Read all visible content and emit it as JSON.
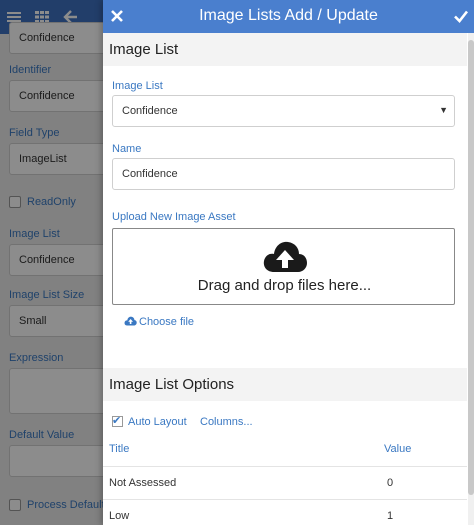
{
  "background": {
    "fields": [
      {
        "label": "",
        "value": "Confidence"
      },
      {
        "label": "Identifier",
        "value": "Confidence"
      },
      {
        "label": "Field Type",
        "value": "ImageList"
      },
      {
        "label": "Image List",
        "value": "Confidence"
      },
      {
        "label": "Image List Size",
        "value": "Small"
      },
      {
        "label": "Expression",
        "value": ""
      },
      {
        "label": "Default Value",
        "value": ""
      }
    ],
    "readonly_label": "ReadOnly",
    "process_default_label": "Process Default"
  },
  "dialog": {
    "title": "Image Lists Add / Update",
    "section_image_list": "Image List",
    "image_list_label": "Image List",
    "image_list_value": "Confidence",
    "name_label": "Name",
    "name_value": "Confidence",
    "upload_label": "Upload New Image Asset",
    "dropzone_text": "Drag and drop files here...",
    "choose_file": "Choose file",
    "section_options": "Image List Options",
    "auto_layout_label": "Auto Layout",
    "auto_layout_checked": true,
    "columns_link": "Columns...",
    "table": {
      "headers": [
        "Title",
        "Value"
      ],
      "rows": [
        [
          "Not Assessed",
          "0"
        ],
        [
          "Low",
          "1"
        ]
      ]
    }
  },
  "colors": {
    "header": "#4a7fce",
    "accent": "#3a78c2"
  },
  "icons": {
    "bg_menu": "menu-icon",
    "bg_grid": "grid-icon",
    "bg_back": "arrow-left-icon",
    "close": "close-icon",
    "confirm": "checkmark-icon",
    "upload": "cloud-upload-icon"
  }
}
